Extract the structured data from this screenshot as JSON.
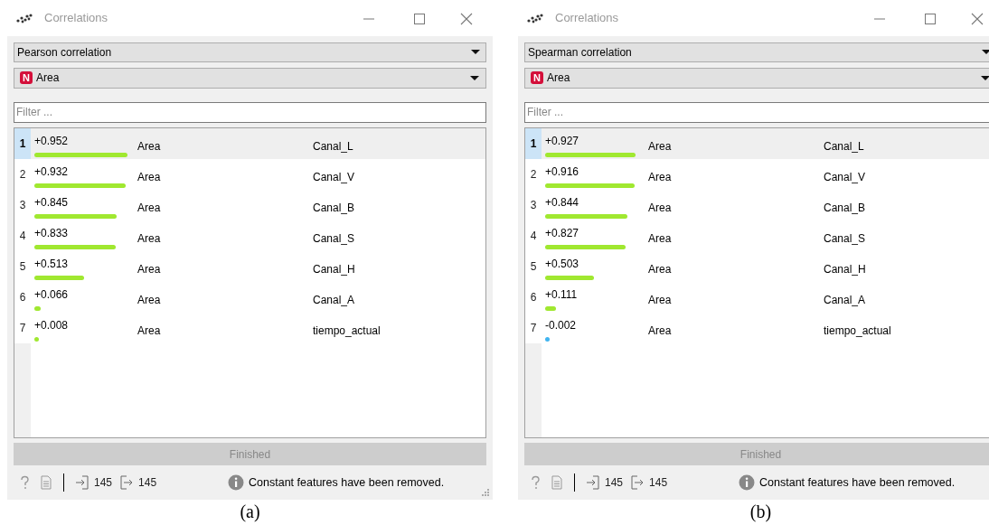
{
  "panels": [
    {
      "window": {
        "title": "Correlations"
      },
      "method": "Pearson correlation",
      "feature": {
        "badge": "N",
        "name": "Area"
      },
      "filter": {
        "placeholder": "Filter ..."
      },
      "rows": [
        {
          "rank": "1",
          "value": "+0.952",
          "color": "#a0e830",
          "selected": true,
          "feature_1": "Area",
          "feature_2": "Canal_L"
        },
        {
          "rank": "2",
          "value": "+0.932",
          "color": "#a0e830",
          "selected": false,
          "feature_1": "Area",
          "feature_2": "Canal_V"
        },
        {
          "rank": "3",
          "value": "+0.845",
          "color": "#a0e830",
          "selected": false,
          "feature_1": "Area",
          "feature_2": "Canal_B"
        },
        {
          "rank": "4",
          "value": "+0.833",
          "color": "#a0e830",
          "selected": false,
          "feature_1": "Area",
          "feature_2": "Canal_S"
        },
        {
          "rank": "5",
          "value": "+0.513",
          "color": "#a0e830",
          "selected": false,
          "feature_1": "Area",
          "feature_2": "Canal_H"
        },
        {
          "rank": "6",
          "value": "+0.066",
          "color": "#a0e830",
          "selected": false,
          "feature_1": "Area",
          "feature_2": "Canal_A"
        },
        {
          "rank": "7",
          "value": "+0.008",
          "color": "#a0e830",
          "selected": false,
          "feature_1": "Area",
          "feature_2": "tiempo_actual"
        }
      ],
      "progress": "Finished",
      "status": {
        "inputs": "145",
        "outputs": "145",
        "message": "Constant features have been removed."
      },
      "resize_grip": true,
      "caption": "(a)"
    },
    {
      "window": {
        "title": "Correlations"
      },
      "method": "Spearman correlation",
      "feature": {
        "badge": "N",
        "name": "Area"
      },
      "filter": {
        "placeholder": "Filter ..."
      },
      "rows": [
        {
          "rank": "1",
          "value": "+0.927",
          "color": "#a0e830",
          "selected": true,
          "feature_1": "Area",
          "feature_2": "Canal_L"
        },
        {
          "rank": "2",
          "value": "+0.916",
          "color": "#a0e830",
          "selected": false,
          "feature_1": "Area",
          "feature_2": "Canal_V"
        },
        {
          "rank": "3",
          "value": "+0.844",
          "color": "#a0e830",
          "selected": false,
          "feature_1": "Area",
          "feature_2": "Canal_B"
        },
        {
          "rank": "4",
          "value": "+0.827",
          "color": "#a0e830",
          "selected": false,
          "feature_1": "Area",
          "feature_2": "Canal_S"
        },
        {
          "rank": "5",
          "value": "+0.503",
          "color": "#a0e830",
          "selected": false,
          "feature_1": "Area",
          "feature_2": "Canal_H"
        },
        {
          "rank": "6",
          "value": "+0.111",
          "color": "#a0e830",
          "selected": false,
          "feature_1": "Area",
          "feature_2": "Canal_A"
        },
        {
          "rank": "7",
          "value": "-0.002",
          "color": "#40b4f0",
          "selected": false,
          "feature_1": "Area",
          "feature_2": "tiempo_actual"
        }
      ],
      "progress": "Finished",
      "status": {
        "inputs": "145",
        "outputs": "145",
        "message": "Constant features have been removed."
      },
      "resize_grip": false,
      "caption": "(b)"
    }
  ]
}
